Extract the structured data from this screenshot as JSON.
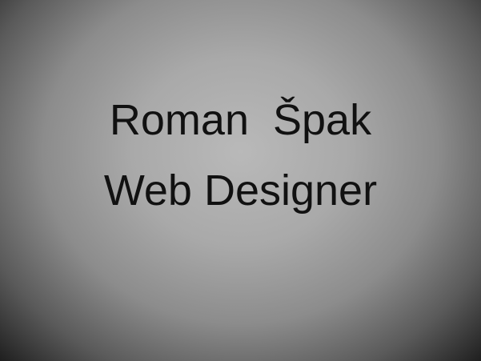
{
  "card": {
    "name": "Roman  Špak",
    "title": "Web Designer"
  },
  "colors": {
    "text": "#111111",
    "background_center": "#b9b9b9",
    "background_edge": "#1f1f1f"
  }
}
